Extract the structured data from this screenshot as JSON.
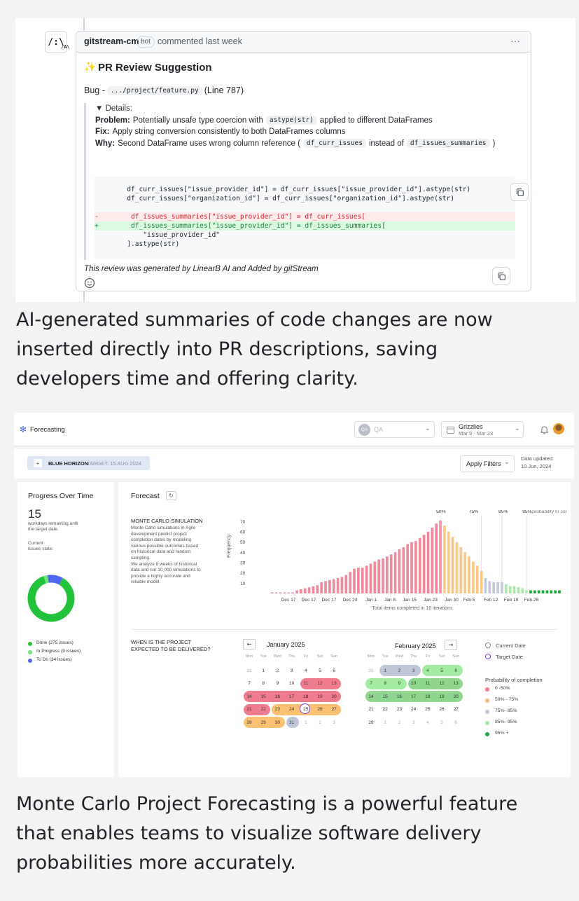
{
  "comment": {
    "logo_text": "/:\\",
    "logo_sub": "/A\\",
    "author": "gitstream-cm",
    "badge": "bot",
    "meta": "commented last week",
    "title": "PR Review Suggestion",
    "sparkle": "✨",
    "bug_prefix": "Bug - ",
    "bug_path": ".../project/feature.py",
    "bug_line": "(Line 787)",
    "details_label": "▼ Details:",
    "problem_label": "Problem:",
    "problem_text_a": "Potentially unsafe type coercion with",
    "problem_code": "astype(str)",
    "problem_text_b": "applied to different DataFrames",
    "fix_label": "Fix:",
    "fix_text": "Apply string conversion consistently to both DataFrames columns",
    "why_label": "Why:",
    "why_text_a": "Second DataFrame uses wrong column reference (",
    "why_code_a": "df_curr_issues",
    "why_text_b": "instead of",
    "why_code_b": "df_issues_summaries",
    "why_text_c": ")",
    "code_lines": [
      "        df_curr_issues[\"issue_provider_id\"] = df_curr_issues[\"issue_provider_id\"].astype(str)",
      "        df_curr_issues[\"organization_id\"] = df_curr_issues[\"organization_id\"].astype(str)",
      "-        df_issues_summaries[\"issue_provider_id\"] = df_curr_issues[",
      "+        df_issues_summaries[\"issue_provider_id\"] = df_issues_summaries[",
      "            \"issue_provider_id\"",
      "        ].astype(str)"
    ],
    "footer": "This review was generated by LinearB AI and Added by gitStream",
    "more": "···"
  },
  "caption1": [
    "AI-generated summaries of code changes are now",
    "inserted directly into PR descriptions, saving",
    "developers time and offering clarity."
  ],
  "caption2": [
    "Monte Carlo Project Forecasting is a powerful feature",
    "that enables teams to visualize software delivery",
    "probabilities more accurately."
  ],
  "app": {
    "title": "Forecasting",
    "qa_avatar": "QA",
    "qa_label": "QA",
    "team_name": "Grizzlies",
    "team_dates": "Mar 9 - Mar 23",
    "project_plus": "+",
    "project": "BLUE HORIZON",
    "target": "TARGET: 15 AUG 2024",
    "apply_filters": "Apply Filters",
    "data_updated_label": "Data updated:",
    "data_updated_value": "10 Jun, 2024"
  },
  "progress": {
    "title": "Progress Over Time",
    "workdays": "15",
    "workdays_text_1": "workdays remaining until",
    "workdays_text_2": "the target date.",
    "state_1": "Current",
    "state_2": "issues state:",
    "legend": [
      {
        "label": "Done (275 issues)",
        "color": "#22c33a",
        "value": 275
      },
      {
        "label": "In Progress (9 issues)",
        "color": "#6ee47e",
        "value": 9
      },
      {
        "label": "To Do (34 issues)",
        "color": "#4f66f0",
        "value": 34
      }
    ]
  },
  "forecast": {
    "title": "Forecast",
    "mc_title": "MONTE CARLO SIMULATION",
    "mc_desc": [
      "Monte Carlo simulations in Agile",
      "development predict project",
      "completion dates by modeling",
      "various possible outcomes based",
      "on historical data and random",
      "sampling.",
      "We analyze 8 weeks of historical",
      "data and run 10,000 simulations to",
      "provide a highly accurate and",
      "reliable model."
    ],
    "when_1": "WHEN IS THE PROJECT",
    "when_2": "EXPECTED TO BE DELIVERED?",
    "pct_50": "50%",
    "pct_75": "75%",
    "pct_85": "85%",
    "pct_95": "95%",
    "pct_95_suffix": "probability to complete"
  },
  "chart_data": {
    "type": "bar",
    "ylabel": "Frequency",
    "xlabel": "Total items completed in 10 iterations",
    "yticks": [
      10,
      20,
      30,
      40,
      50,
      60,
      70
    ],
    "ylim": [
      0,
      75
    ],
    "xtick_labels": [
      "Dec 17",
      "Dec 17",
      "Dec 17",
      "Dec 24",
      "Jan 1",
      "Jan 8",
      "Jan 15",
      "Jan 23",
      "Jan 30",
      "Feb 5",
      "Feb 12",
      "Feb 19",
      "Feb 26"
    ],
    "values": [
      1,
      1,
      1,
      1,
      1,
      1,
      3,
      4,
      5,
      6,
      7,
      8,
      11,
      12,
      13,
      14,
      15,
      16,
      18,
      21,
      24,
      25,
      25,
      27,
      29,
      31,
      33,
      34,
      36,
      38,
      40,
      43,
      45,
      48,
      50,
      51,
      54,
      57,
      60,
      64,
      68,
      71,
      66,
      60,
      55,
      50,
      45,
      40,
      36,
      31,
      27,
      22,
      15,
      12,
      11,
      11,
      11,
      9,
      7,
      7,
      6,
      5,
      3,
      3,
      3,
      3,
      3,
      3,
      3,
      3,
      3
    ],
    "bands": [
      {
        "range": [
          0,
          41
        ],
        "label": "0 -50%",
        "color": "#f08a9a"
      },
      {
        "range": [
          42,
          51
        ],
        "label": "50% - 75%",
        "color": "#fbc883"
      },
      {
        "range": [
          52,
          56
        ],
        "label": "75%- 85%",
        "color": "#c3c9db"
      },
      {
        "range": [
          57,
          62
        ],
        "label": "85%- 95%",
        "color": "#a7eaa7"
      },
      {
        "range": [
          63,
          70
        ],
        "label": "95% +",
        "color": "#1fa33b"
      }
    ]
  },
  "calendar": {
    "month1": "January 2025",
    "month2": "February 2025",
    "prev": "←",
    "next": "→",
    "weekdays": [
      "Mon",
      "Tue",
      "Wed",
      "Thu",
      "Fri",
      "Sat",
      "Sun"
    ],
    "jan_rows": [
      [
        "31",
        "1",
        "2",
        "3",
        "4",
        "5",
        "6"
      ],
      [
        "7",
        "8",
        "9",
        "10",
        "11",
        "12",
        "13"
      ],
      [
        "14",
        "15",
        "16",
        "17",
        "18",
        "19",
        "20"
      ],
      [
        "21",
        "22",
        "23",
        "24",
        "25",
        "26",
        "27"
      ],
      [
        "28",
        "29",
        "30",
        "31",
        "1",
        "2",
        "3"
      ]
    ],
    "feb_rows": [
      [
        "31",
        "1",
        "2",
        "3",
        "4",
        "5",
        "6"
      ],
      [
        "7",
        "8",
        "9",
        "10",
        "11",
        "12",
        "13"
      ],
      [
        "14",
        "15",
        "16",
        "17",
        "18",
        "19",
        "20"
      ],
      [
        "21",
        "22",
        "23",
        "24",
        "25",
        "26",
        "27"
      ],
      [
        "28",
        "1",
        "2",
        "3",
        "4",
        "5",
        "6"
      ]
    ],
    "legend_current": "Current Date",
    "legend_target": "Target Date",
    "prob_title": "Probability of completion",
    "prob_items": [
      {
        "label": "0 -50%",
        "color": "#f07b8d"
      },
      {
        "label": "50% - 75%",
        "color": "#fbc173"
      },
      {
        "label": "75%- 85%",
        "color": "#bfc6d8"
      },
      {
        "label": "85%- 95%",
        "color": "#a3eba3"
      },
      {
        "label": "95% +",
        "color": "#26a844"
      }
    ]
  }
}
